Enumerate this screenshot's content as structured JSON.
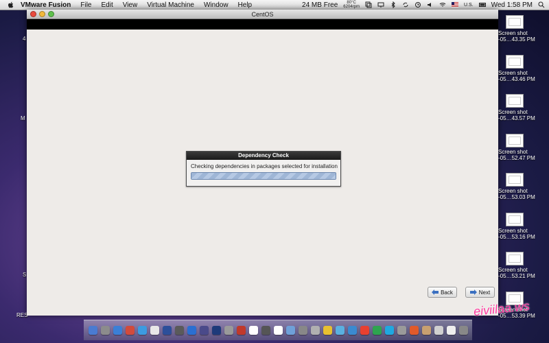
{
  "menubar": {
    "app_name": "VMware Fusion",
    "items": [
      "File",
      "Edit",
      "View",
      "Virtual Machine",
      "Window",
      "Help"
    ],
    "memory": "24 MB Free",
    "temp_line1": "80°C",
    "temp_line2": "6204rpm",
    "locale": "U.S.",
    "clock": "Wed 1:58 PM"
  },
  "window": {
    "title": "CentOS"
  },
  "dialog": {
    "title": "Dependency Check",
    "message": "Checking dependencies in packages selected for installation",
    "progress": 1.0
  },
  "buttons": {
    "back": "Back",
    "next": "Next"
  },
  "desktop_icons": [
    {
      "line1": "Screen shot",
      "line2": "-05…43.35 PM"
    },
    {
      "line1": "Screen shot",
      "line2": "-05…43.46 PM"
    },
    {
      "line1": "Screen shot",
      "line2": "-05…43.57 PM"
    },
    {
      "line1": "Screen shot",
      "line2": "-05…52.47 PM"
    },
    {
      "line1": "Screen shot",
      "line2": "-05…53.03 PM"
    },
    {
      "line1": "Screen shot",
      "line2": "-05…53.16 PM"
    },
    {
      "line1": "Screen shot",
      "line2": "-05…53.21 PM"
    },
    {
      "line1": "Screen shot",
      "line2": "-05…53.39 PM"
    }
  ],
  "left_labels": [
    "4",
    "M",
    "S",
    "RES"
  ],
  "dock_colors": [
    "#4a7bd1",
    "#8c8c8c",
    "#3b7fd6",
    "#d24b3c",
    "#3c9be0",
    "#e8e8e8",
    "#2d4f9a",
    "#5a5a5a",
    "#2b6fd1",
    "#4a4a8a",
    "#1e3a7a",
    "#9a9a9a",
    "#c0392b",
    "#ffffff",
    "#555555",
    "#ffffff",
    "#6fa0d8",
    "#888888",
    "#b0b0b0",
    "#e8c030",
    "#5ab0e0",
    "#3a8ad0",
    "#e84030",
    "#2ea44f",
    "#1fa8e0",
    "#9a9a9a",
    "#e05a2a",
    "#c8a070",
    "#d0d0d0",
    "#eeeeee",
    "#888888"
  ],
  "watermark": "eiviilaa.ws"
}
